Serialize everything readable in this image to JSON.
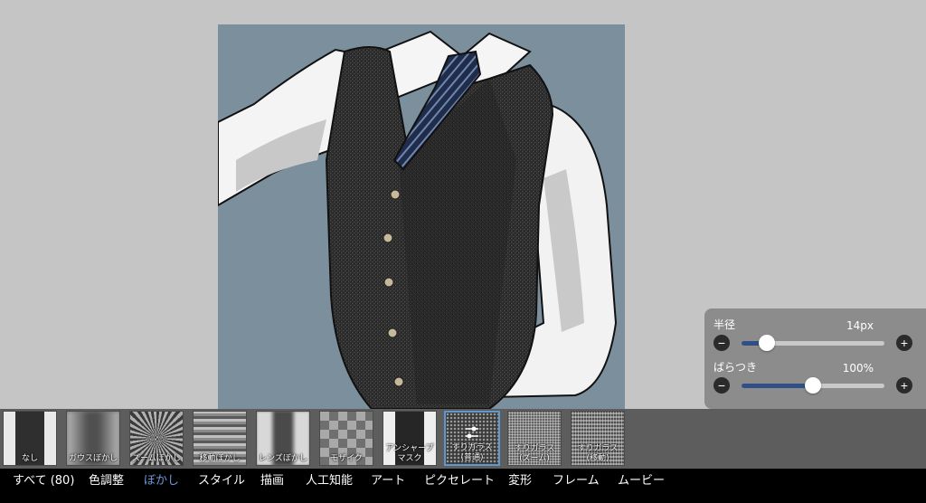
{
  "adjust_panel": {
    "radius": {
      "label": "半径",
      "value_text": "14px",
      "level": 0.18
    },
    "variation": {
      "label": "ばらつき",
      "value_text": "100%",
      "level": 0.5
    },
    "minus_glyph": "−",
    "plus_glyph": "+"
  },
  "filters": [
    {
      "label": "なし"
    },
    {
      "label": "ガウスぼかし"
    },
    {
      "label": "ズームぼかし"
    },
    {
      "label": "移動ぼかし"
    },
    {
      "label": "レンズぼかし"
    },
    {
      "label": "モザイク"
    },
    {
      "label": "アンシャープ\nマスク"
    },
    {
      "label": "すりガラス\n(普通)",
      "selected": true
    },
    {
      "label": "すりガラス\n(ズーム)"
    },
    {
      "label": "すりガラス\n(移動)"
    }
  ],
  "categories": [
    {
      "label": "すべて (80)"
    },
    {
      "label": "色調整"
    },
    {
      "label": "ぼかし",
      "active": true
    },
    {
      "label": "スタイル"
    },
    {
      "label": "描画"
    },
    {
      "label": "人工知能"
    },
    {
      "label": "アート"
    },
    {
      "label": "ピクセレート"
    },
    {
      "label": "変形"
    },
    {
      "label": "フレーム"
    },
    {
      "label": "ムービー"
    }
  ],
  "colors": {
    "canvas_background": "#c5c5c5",
    "artwork_background": "#7b8f9c",
    "accent": "#6f9bdb",
    "slider_fill": "#2f4f86",
    "panel": "#8c8c8c"
  }
}
